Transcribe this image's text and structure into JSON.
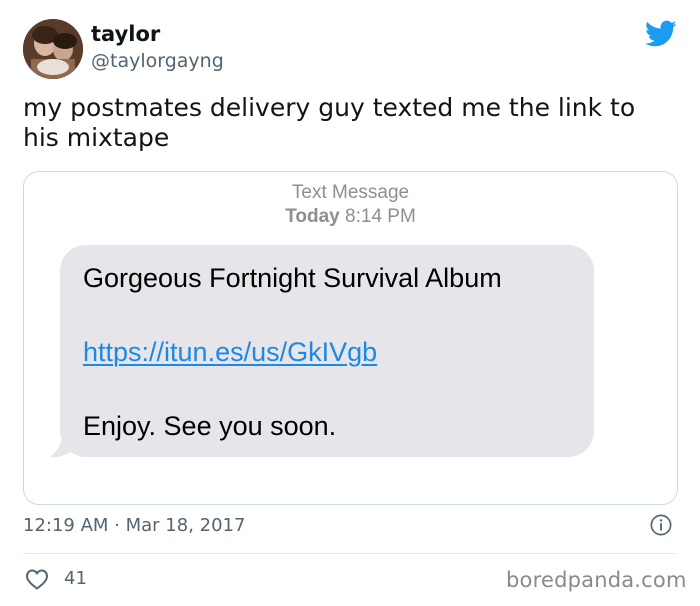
{
  "author": {
    "display_name": "taylor",
    "handle": "@taylorgayng"
  },
  "tweet": {
    "text": "my postmates delivery guy texted me the link to his mixtape",
    "timestamp": "12:19 AM · Mar 18, 2017",
    "like_count": "41"
  },
  "sms": {
    "header_label": "Text Message",
    "date_label": "Today",
    "time_label": "8:14 PM",
    "lines": [
      "Gorgeous Fortnight Survival Album",
      "https://itun.es/us/GkIVgb",
      "Enjoy. See you soon."
    ]
  },
  "watermark": "boredpanda.com",
  "icons": {
    "brand": "twitter-bird-icon",
    "info": "info-icon",
    "like": "heart-icon"
  },
  "colors": {
    "twitter_blue": "#1d9bf0",
    "link_blue": "#1e88e5",
    "bubble_gray": "#e5e5ea",
    "secondary_text": "#536471"
  }
}
